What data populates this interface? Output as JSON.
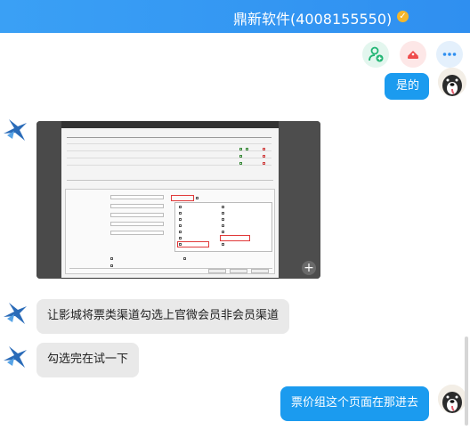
{
  "header": {
    "title": "鼎新软件(4008155550)",
    "verified_icon": "verified-badge-icon"
  },
  "toolbar": {
    "icons": [
      "add-contact-icon",
      "service-hat-icon",
      "more-icon"
    ]
  },
  "messages": [
    {
      "side": "out",
      "type": "text",
      "text": "是的"
    },
    {
      "side": "in",
      "type": "image",
      "description_icon": "screenshot-image"
    },
    {
      "side": "in",
      "type": "text",
      "text": "让影城将票类渠道勾选上官微会员非会员渠道"
    },
    {
      "side": "in",
      "type": "text",
      "text": "勾选完在试一下"
    },
    {
      "side": "out",
      "type": "text",
      "text": "票价组这个页面在那进去"
    }
  ],
  "colors": {
    "header": "#2f8ff0",
    "outgoing": "#1b9bef",
    "incoming": "#e9e9e9",
    "verified": "#f4b62a"
  }
}
